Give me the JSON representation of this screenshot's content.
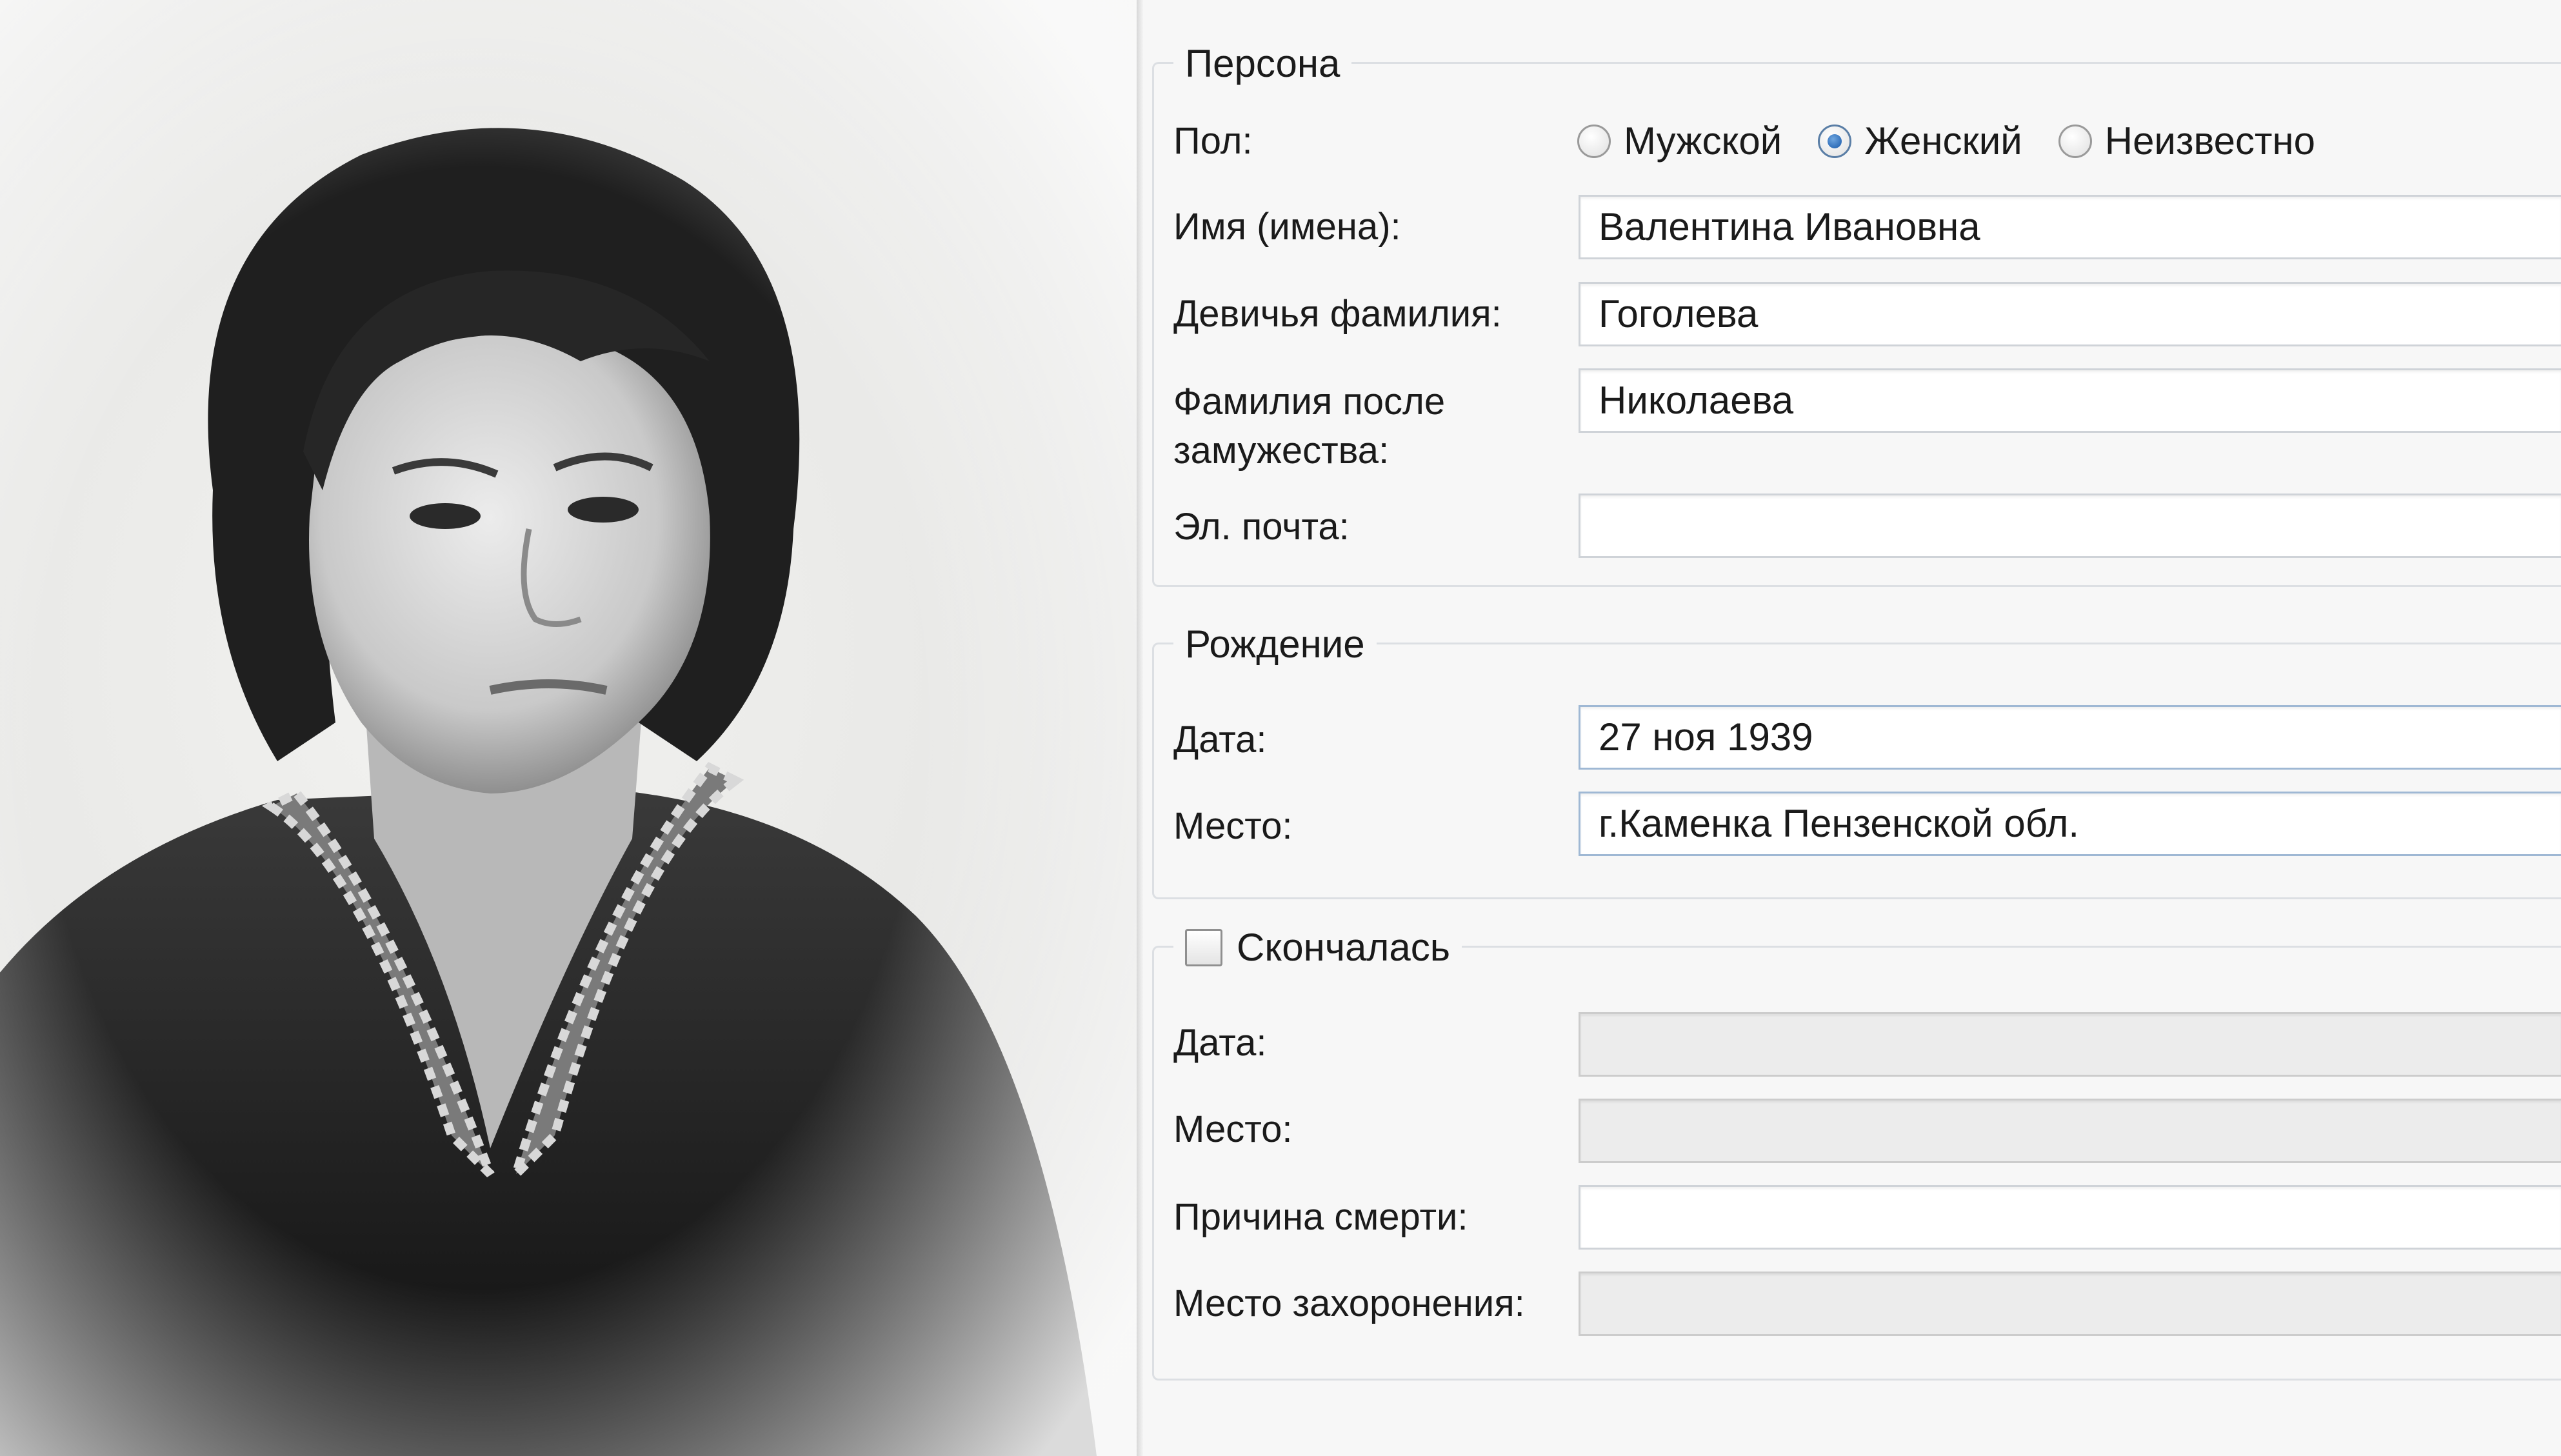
{
  "person": {
    "legend": "Персона",
    "gender": {
      "label": "Пол:",
      "options": [
        "Мужской",
        "Женский",
        "Неизвестно"
      ],
      "selected": "Женский"
    },
    "given_names": {
      "label": "Имя (имена):",
      "value": "Валентина Ивановна"
    },
    "maiden_name": {
      "label": "Девичья фамилия:",
      "value": "Гоголева"
    },
    "married_name": {
      "label_line1": "Фамилия после",
      "label_line2": "замужества:",
      "value": "Николаева"
    },
    "email": {
      "label": "Эл. почта:",
      "value": ""
    }
  },
  "birth": {
    "legend": "Рождение",
    "date": {
      "label": "Дата:",
      "value": "27 ноя 1939"
    },
    "place": {
      "label": "Место:",
      "value": "г.Каменка Пензенской обл."
    }
  },
  "death": {
    "legend": "Скончалась",
    "deceased_checked": false,
    "date": {
      "label": "Дата:",
      "value": ""
    },
    "place": {
      "label": "Место:",
      "value": ""
    },
    "cause": {
      "label": "Причина смерти:",
      "value": ""
    },
    "burial_place": {
      "label": "Место захоронения:",
      "value": ""
    }
  },
  "colors": {
    "form_background": "#f7f7f7",
    "group_border": "#dcdfe3",
    "radio_selected": "#1f5fae"
  }
}
